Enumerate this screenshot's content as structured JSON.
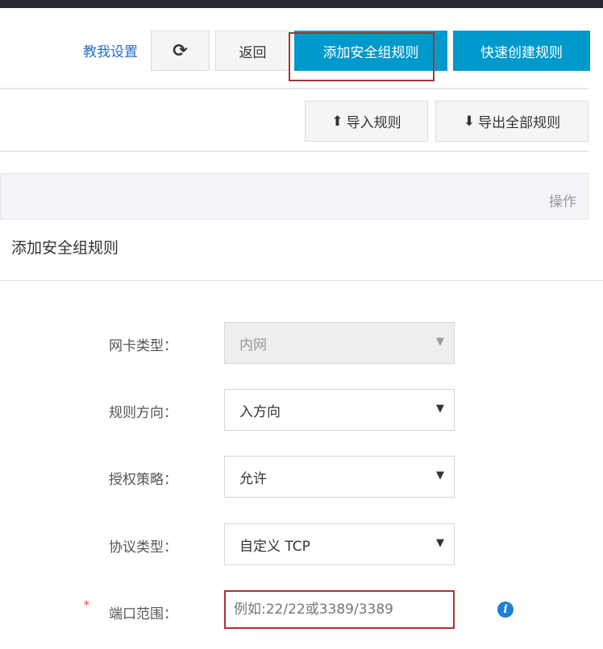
{
  "toolbar": {
    "help_link": "教我设置",
    "refresh_icon": "refresh-icon",
    "back": "返回",
    "add_rule": "添加安全组规则",
    "quick_create": "快速创建规则"
  },
  "actions": {
    "import": "导入规则",
    "export": "导出全部规则",
    "import_icon": "upload-icon",
    "export_icon": "download-icon"
  },
  "table": {
    "col_action": "操作"
  },
  "dialog": {
    "title": "添加安全组规则",
    "fields": [
      {
        "label": "网卡类型：",
        "value": "内网",
        "disabled": true
      },
      {
        "label": "规则方向：",
        "value": "入方向"
      },
      {
        "label": "授权策略：",
        "value": "允许"
      },
      {
        "label": "协议类型：",
        "value": "自定义 TCP"
      },
      {
        "label": "端口范围：",
        "required_mark": "*",
        "placeholder": "例如:22/22或3389/3389",
        "info_icon": "info-icon"
      }
    ]
  },
  "colors": {
    "primary": "#0099cc",
    "highlight": "#a33333",
    "link": "#2b6cc4"
  }
}
